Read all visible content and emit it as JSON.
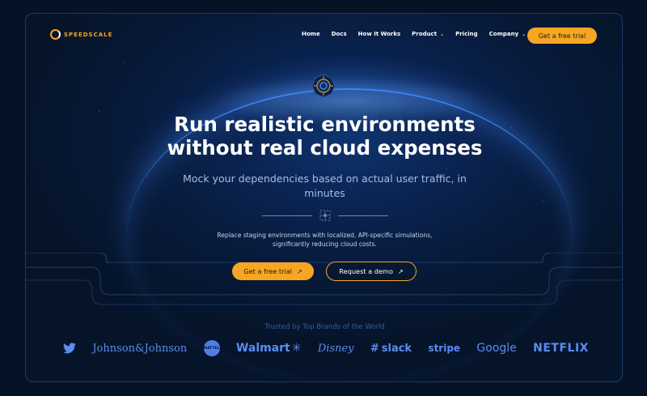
{
  "brand": {
    "name": "SPEEDSCALE"
  },
  "nav": {
    "items": [
      {
        "label": "Home",
        "dropdown": false
      },
      {
        "label": "Docs",
        "dropdown": false
      },
      {
        "label": "How It Works",
        "dropdown": false
      },
      {
        "label": "Product",
        "dropdown": true
      },
      {
        "label": "Pricing",
        "dropdown": false
      },
      {
        "label": "Company",
        "dropdown": true
      }
    ],
    "cta_label": "Get a free trial"
  },
  "hero": {
    "headline_line1": "Run realistic environments",
    "headline_line2": "without real cloud expenses",
    "sub_line1": "Mock your dependencies based on actual user traffic, in",
    "sub_line2": "minutes",
    "desc_line1": "Replace staging environments with localized, API-specific simulations,",
    "desc_line2": "significantly reducing cloud costs.",
    "primary_cta": "Get a free trial",
    "secondary_cta": "Request a demo"
  },
  "trusted": {
    "label": "Trusted by Top Brands of the World",
    "logos": [
      "twitter",
      "Johnson&Johnson",
      "MATTEL",
      "Walmart",
      "Disney",
      "slack",
      "stripe",
      "Google",
      "NETFLIX"
    ]
  },
  "colors": {
    "accent": "#f6a623",
    "background": "#061326",
    "logo_blue": "#5b8cf2"
  }
}
